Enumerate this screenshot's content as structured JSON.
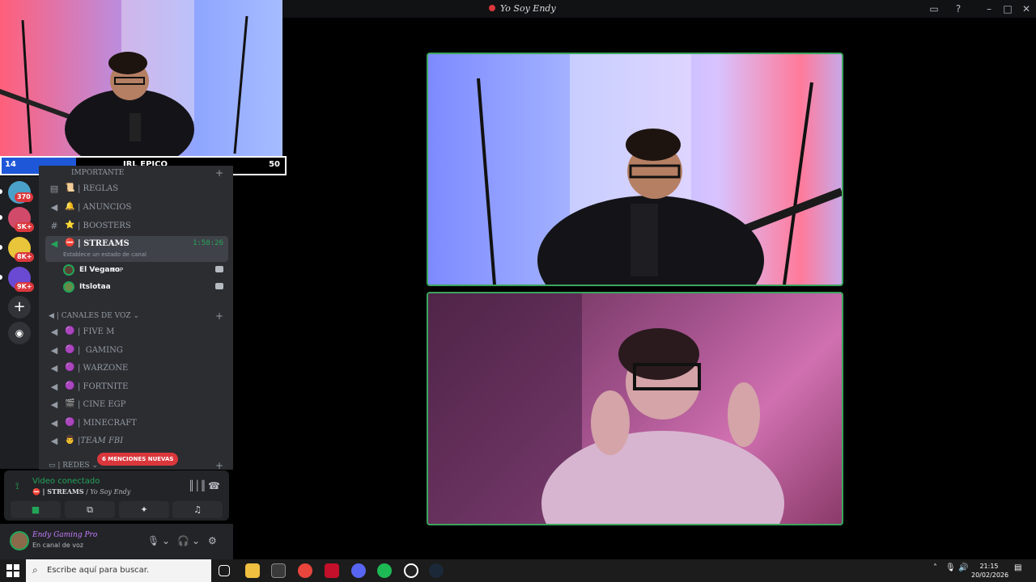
{
  "window": {
    "title": "Yo Soy Endy"
  },
  "stream_overlay": {
    "left_number": "14",
    "label": "IRL EPICO",
    "right_number": "50"
  },
  "servers": [
    {
      "badge": "370",
      "color": "#4aa0c8"
    },
    {
      "badge": "5K+",
      "color": "#d24a6a"
    },
    {
      "badge": "8K+",
      "color": "#e8c53a"
    },
    {
      "badge": "9K+",
      "color": "#6a4ad2"
    }
  ],
  "channels": {
    "category_top": "IMPORTANTE",
    "items": [
      {
        "icon": "rules-icon",
        "emoji": "📜",
        "name": "| REGLAS"
      },
      {
        "icon": "announcement-icon",
        "emoji": "🔔",
        "name": "| ANUNCIOS"
      },
      {
        "icon": "hash-icon",
        "emoji": "⭐",
        "name": "| BOOSTERS"
      }
    ],
    "active": {
      "emoji": "⛔",
      "name": "| STREAMS",
      "timer": "1:58:26",
      "status": "Establece un estado de canal"
    },
    "users": [
      {
        "name": "El Vegano",
        "tag": "EGP"
      },
      {
        "name": "Itslotaa",
        "tag": ""
      }
    ],
    "voice_category": "CANALES DE VOZ",
    "voice_items": [
      {
        "emoji": "🟣",
        "name": "| FIVE M"
      },
      {
        "emoji": "🟣",
        "name": "|  GAMING"
      },
      {
        "emoji": "🟣",
        "name": "| WARZONE"
      },
      {
        "emoji": "🟣",
        "name": "| FORTNITE"
      },
      {
        "emoji": "🎬",
        "name": "| CINE EGP"
      },
      {
        "emoji": "🟣",
        "name": "| MINECRAFT"
      },
      {
        "emoji": "👨",
        "name": "|TEAM FBI"
      }
    ],
    "redes_category": "REDES",
    "mentions": "6 MENCIONES NUEVAS"
  },
  "voice_panel": {
    "status": "Video conectado",
    "channel": "| STREAMS",
    "server": "Yo Soy Endy"
  },
  "user_panel": {
    "name": "Endy Gaming Pro",
    "status": "En canal de voz"
  },
  "taskbar": {
    "search_placeholder": "Escribe aquí para buscar.",
    "time": "21:15",
    "date": "20/02/2026"
  }
}
